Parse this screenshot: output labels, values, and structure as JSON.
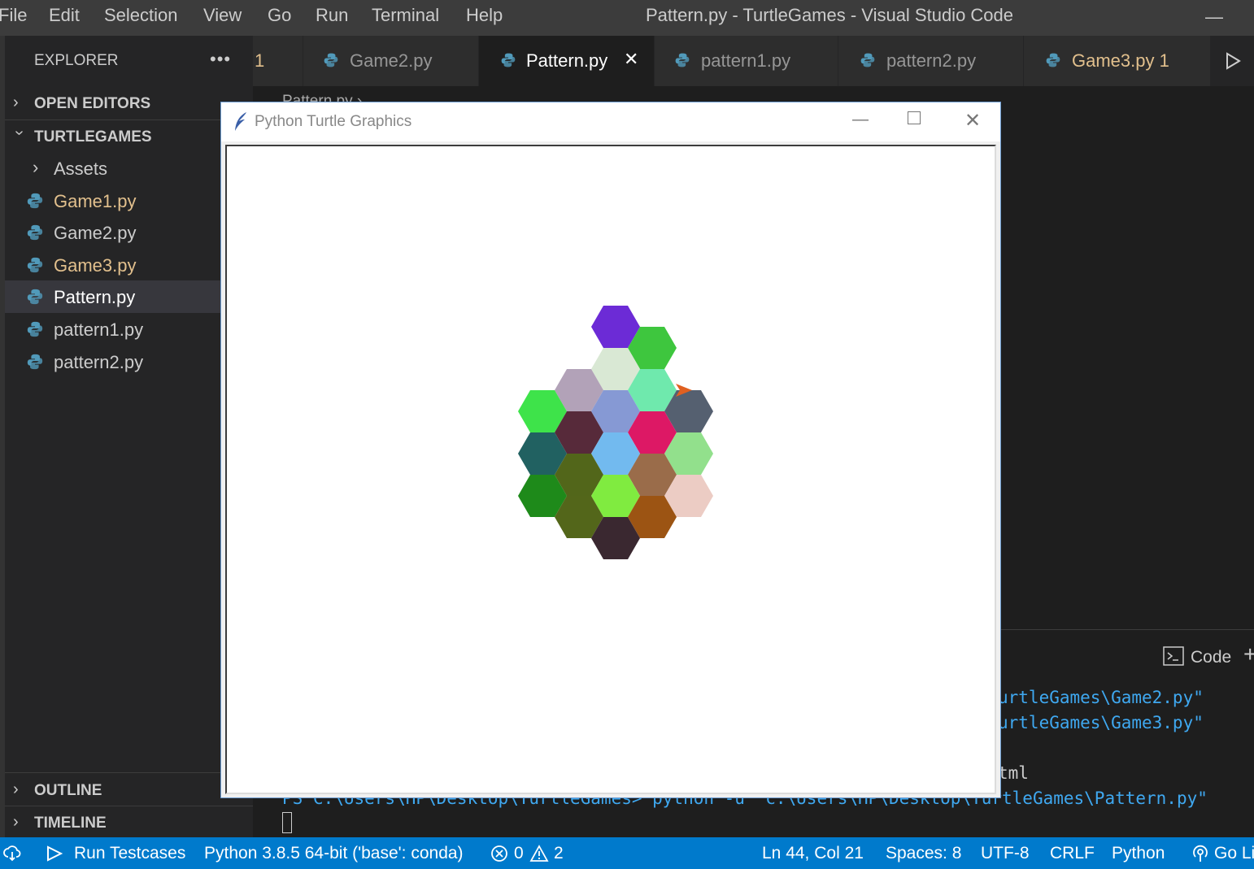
{
  "menu": [
    "File",
    "Edit",
    "Selection",
    "View",
    "Go",
    "Run",
    "Terminal",
    "Help"
  ],
  "window_title": "Pattern.py - TurtleGames - Visual Studio Code",
  "sidebar": {
    "title": "EXPLORER",
    "more": "•••",
    "open_editors": "OPEN EDITORS",
    "workspace": "TURTLEGAMES",
    "items": [
      {
        "name": "Assets",
        "type": "folder",
        "color": "#cccccc"
      },
      {
        "name": "Game1.py",
        "type": "python",
        "color": "#e2c08d"
      },
      {
        "name": "Game2.py",
        "type": "python",
        "color": "#cccccc"
      },
      {
        "name": "Game3.py",
        "type": "python",
        "color": "#e2c08d"
      },
      {
        "name": "Pattern.py",
        "type": "python",
        "color": "#ffffff"
      },
      {
        "name": "pattern1.py",
        "type": "python",
        "color": "#cccccc"
      },
      {
        "name": "pattern2.py",
        "type": "python",
        "color": "#cccccc"
      }
    ],
    "outline": "OUTLINE",
    "timeline": "TIMELINE"
  },
  "tabs": [
    {
      "label": "1",
      "icon": "none",
      "color": "#e2c08d",
      "active": false
    },
    {
      "label": "Game2.py",
      "icon": "python-icon",
      "color": "#969696",
      "active": false
    },
    {
      "label": "Pattern.py",
      "icon": "python-icon",
      "color": "#ffffff",
      "active": true,
      "close": "✕"
    },
    {
      "label": "pattern1.py",
      "icon": "python-icon",
      "color": "#969696",
      "active": false
    },
    {
      "label": "pattern2.py",
      "icon": "python-icon",
      "color": "#969696",
      "active": false
    },
    {
      "label": "Game3.py 1",
      "icon": "python-icon",
      "color": "#e2c08d",
      "active": false
    }
  ],
  "breadcrumb": "Pattern.py ›",
  "panel": {
    "terminal_select": "Code",
    "lines": [
      "urtleGames\\Game2.py\"",
      "urtleGames\\Game3.py\"",
      "tml",
      "PS C:\\Users\\HP\\Desktop\\TurtleGames> python -u \"c:\\Users\\HP\\Desktop\\TurtleGames\\Pattern.py\""
    ]
  },
  "turtle_window": {
    "title": "Python Turtle Graphics",
    "hexagons": [
      {
        "col": 2,
        "row": 0,
        "color": "#6c2bd6"
      },
      {
        "col": 3,
        "row": 0.5,
        "color": "#3ec63e"
      },
      {
        "col": 2,
        "row": 1,
        "color": "#d9e8d4"
      },
      {
        "col": 1,
        "row": 1.5,
        "color": "#b2a2b8"
      },
      {
        "col": 3,
        "row": 1.5,
        "color": "#6fe9ad"
      },
      {
        "col": 0,
        "row": 2,
        "color": "#3ee34a"
      },
      {
        "col": 2,
        "row": 2,
        "color": "#8699d4"
      },
      {
        "col": 4,
        "row": 2,
        "color": "#556070"
      },
      {
        "col": 1,
        "row": 2.5,
        "color": "#572a3a"
      },
      {
        "col": 3,
        "row": 2.5,
        "color": "#dd1865"
      },
      {
        "col": 0,
        "row": 3,
        "color": "#216161"
      },
      {
        "col": 2,
        "row": 3,
        "color": "#72baef"
      },
      {
        "col": 4,
        "row": 3,
        "color": "#92e08c"
      },
      {
        "col": 1,
        "row": 3.5,
        "color": "#52661a"
      },
      {
        "col": 3,
        "row": 3.5,
        "color": "#9a6c4a"
      },
      {
        "col": 0,
        "row": 4,
        "color": "#1e8a1a"
      },
      {
        "col": 2,
        "row": 4,
        "color": "#80eb40"
      },
      {
        "col": 4,
        "row": 4,
        "color": "#ecccc4"
      },
      {
        "col": 1,
        "row": 4.5,
        "color": "#53661a"
      },
      {
        "col": 3,
        "row": 4.5,
        "color": "#9c5413"
      },
      {
        "col": 2,
        "row": 5,
        "color": "#3a2830"
      }
    ],
    "turtle_color": "#e06020"
  },
  "status": {
    "run_testcases": "Run Testcases",
    "python": "Python 3.8.5 64-bit ('base': conda)",
    "errors": "0",
    "warnings": "2",
    "position": "Ln 44, Col 21",
    "spaces": "Spaces: 8",
    "encoding": "UTF-8",
    "eol": "CRLF",
    "language": "Python",
    "golive": "Go Li"
  }
}
